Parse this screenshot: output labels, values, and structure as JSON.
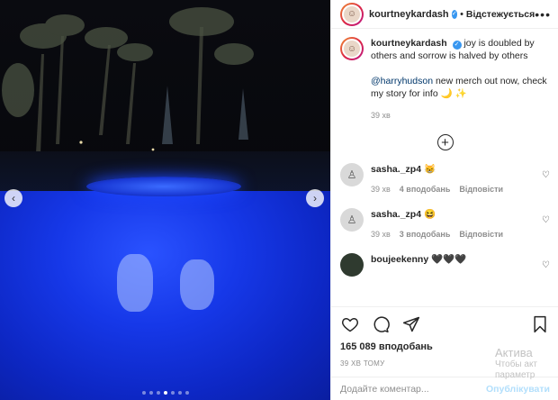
{
  "post": {
    "username": "kourtneykardash",
    "follow_state": "Відстежується",
    "more_label": "•••",
    "verified_mark": "✓",
    "caption_text": "joy is doubled by others and sorrow is halved by others",
    "mention": "@harryhudson",
    "caption_text2": " new merch out now, check my story for info 🌙 ✨",
    "caption_time": "39 хв",
    "likes": "165 089 вподобань",
    "post_time": "39 ХВ ТОМУ"
  },
  "comments": [
    {
      "user": "sasha._zp4",
      "text": "😸",
      "time": "39 хв",
      "likes": "4 вподобань",
      "reply": "Відповісти"
    },
    {
      "user": "sasha._zp4",
      "text": "😆",
      "time": "39 хв",
      "likes": "3 вподобань",
      "reply": "Відповісти"
    },
    {
      "user": "boujeekenny",
      "text": "🖤🖤🖤"
    }
  ],
  "add_comment": {
    "placeholder": "Додайте коментар...",
    "publish": "Опублікувати"
  },
  "watermark": {
    "line1": "Актива",
    "line2": "Чтобы акт",
    "line3": "параметр"
  },
  "carousel": {
    "count": 7,
    "active_index": 3
  },
  "icons": [
    "heart-icon",
    "comment-icon",
    "share-icon",
    "bookmark-icon",
    "add-icon",
    "chevron-left-icon",
    "chevron-right-icon",
    "more-icon"
  ],
  "colors": {
    "pool_blue": "#1638e8",
    "link": "#00376b",
    "muted": "#8e8e8e",
    "publish_disabled": "#b2dffc"
  }
}
